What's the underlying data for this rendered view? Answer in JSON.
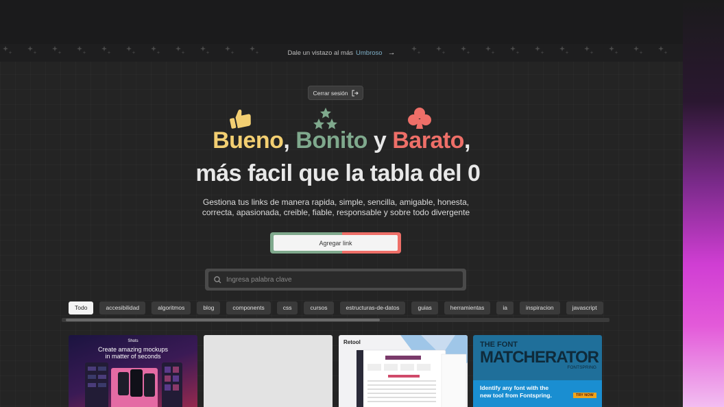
{
  "banner": {
    "text": "Dale un vistazo al más",
    "accent": "Umbroso"
  },
  "header": {
    "logout_label": "Cerrar sesión"
  },
  "hero": {
    "word1": "Bueno",
    "word2": "Bonito",
    "connector": "y",
    "word3": "Barato",
    "line2": "más facil que la tabla del 0",
    "subtitle_line1": "Gestiona tus links de manera rapida, simple, sencilla, amigable, honesta,",
    "subtitle_line2": "correcta, apasionada, creible, fiable, responsable y sobre todo divergente"
  },
  "actions": {
    "add_link_label": "Agregar link"
  },
  "search": {
    "placeholder": "Ingresa palabra clave"
  },
  "tags": [
    "Todo",
    "accesibilidad",
    "algoritmos",
    "blog",
    "components",
    "css",
    "cursos",
    "estructuras-de-datos",
    "guias",
    "herramientas",
    "ia",
    "inspiracion",
    "javascript"
  ],
  "tags_active_index": 0,
  "cards": {
    "card1": {
      "logo": "Shots",
      "title_line1": "Create amazing mockups",
      "title_line2": "in matter of seconds"
    },
    "card3": {
      "logo": "Retool"
    },
    "card4": {
      "title1": "THE FONT",
      "title2": "MATCHERATOR",
      "brand": "FONTSPRING",
      "desc_line1": "Identify any font with the",
      "desc_line2": "new tool from Fontspring.",
      "cta": "TRY NOW"
    }
  },
  "colors": {
    "yellow": "#f3cf72",
    "green": "#7fa98d",
    "red": "#ee6f68",
    "accent_blue": "#7fb0c8"
  }
}
